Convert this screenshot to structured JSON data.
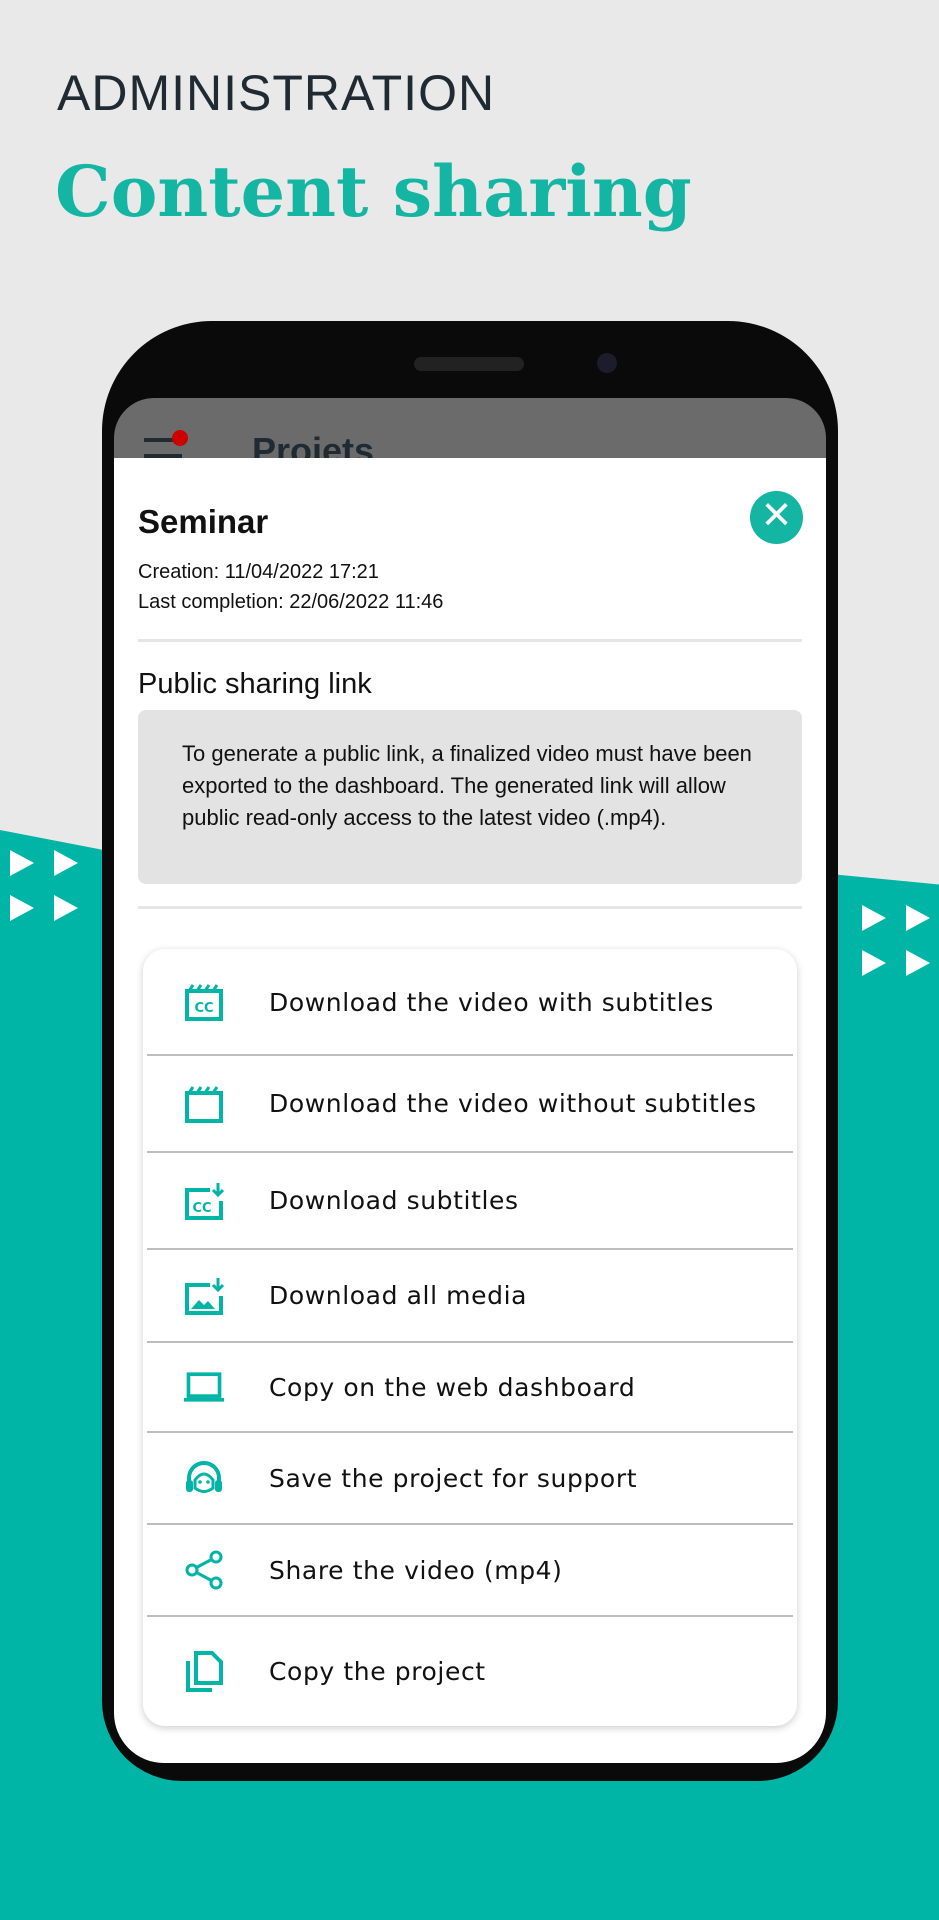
{
  "header": {
    "kicker": "ADMINISTRATION",
    "headline": "Content sharing"
  },
  "app": {
    "background_title": "Projets"
  },
  "project": {
    "name": "Seminar",
    "creation": "Creation: 11/04/2022 17:21",
    "last_completion": "Last completion: 22/06/2022 11:46"
  },
  "sharing": {
    "title": "Public sharing link",
    "info": "To generate a public link, a finalized video must have been exported to the dashboard. The generated link will allow public read-only access to the latest video (.mp4)."
  },
  "menu": [
    {
      "label": "Download the video with subtitles",
      "icon": "clapper-cc-icon"
    },
    {
      "label": "Download the video without subtitles",
      "icon": "clapper-icon"
    },
    {
      "label": "Download subtitles",
      "icon": "cc-download-icon"
    },
    {
      "label": "Download all media",
      "icon": "image-download-icon"
    },
    {
      "label": "Copy on the web dashboard",
      "icon": "laptop-icon"
    },
    {
      "label": "Save the project for support",
      "icon": "headset-icon"
    },
    {
      "label": "Share the video (mp4)",
      "icon": "share-icon"
    },
    {
      "label": "Copy the project",
      "icon": "copy-icon"
    }
  ],
  "colors": {
    "accent": "#00b5a6",
    "text": "#111111",
    "background": "#e8e9e8"
  }
}
